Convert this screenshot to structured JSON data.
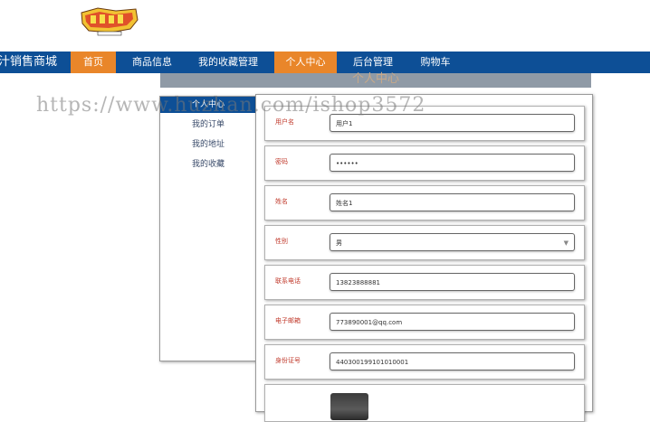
{
  "header": {
    "logo_icon": "cartoon-logo-icon",
    "brand": "汁销售商城"
  },
  "nav": {
    "items": [
      {
        "label": "首页",
        "active": true
      },
      {
        "label": "商品信息",
        "active": false
      },
      {
        "label": "我的收藏管理",
        "active": false
      },
      {
        "label": "个人中心",
        "active": true
      },
      {
        "label": "后台管理",
        "active": false
      },
      {
        "label": "购物车",
        "active": false
      }
    ]
  },
  "watermark": "https://www.huzhan.com/ishop3572",
  "sidebar": {
    "items": [
      {
        "label": "个人中心",
        "active": true
      },
      {
        "label": "我的订单",
        "active": false
      },
      {
        "label": "我的地址",
        "active": false
      },
      {
        "label": "我的收藏",
        "active": false
      }
    ]
  },
  "form": {
    "fields": [
      {
        "label": "用户名",
        "value": "用户1",
        "type": "text"
      },
      {
        "label": "密码",
        "value": "••••••",
        "type": "password"
      },
      {
        "label": "姓名",
        "value": "姓名1",
        "type": "text"
      },
      {
        "label": "性别",
        "value": "男",
        "type": "select"
      },
      {
        "label": "联系电话",
        "value": "13823888881",
        "type": "text"
      },
      {
        "label": "电子邮箱",
        "value": "773890001@qq.com",
        "type": "text"
      },
      {
        "label": "身份证号",
        "value": "440300199101010001",
        "type": "text"
      }
    ]
  },
  "colors": {
    "nav_bg": "#0d4f96",
    "nav_active": "#e9862a",
    "label_red": "#c0392b"
  }
}
